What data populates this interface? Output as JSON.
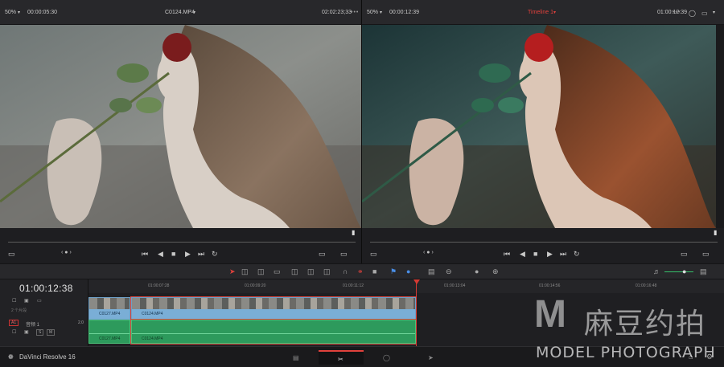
{
  "left_viewer": {
    "zoom": "50%",
    "source_timecode": "00:00:05:30",
    "clip_name": "C0124.MP4",
    "duration": "02:02:23;33",
    "more": "•••"
  },
  "right_viewer": {
    "zoom": "50%",
    "source_timecode": "00:00:12:39",
    "timeline_name": "Timeline 1",
    "record_timecode": "01:00:12:39",
    "more": "•••"
  },
  "timeline": {
    "timecode": "01:00:12:38",
    "ruler_ticks": [
      "01:00:07:28",
      "01:00:09:20",
      "01:00:11:12",
      "01:00:13:04",
      "01:00:14:56",
      "01:00:16:48"
    ],
    "video_track_name": "2 个片段",
    "audio_track_id": "A1",
    "audio_track_name": "音频 1",
    "audio_level": "2.0",
    "audio_s": "S",
    "audio_m": "M",
    "clips": {
      "v1_a": "C0127.MP4",
      "v1_b": "C0124.MP4",
      "a1_a": "C0127.MP4",
      "a1_b": "C0124.MP4"
    }
  },
  "bottom_bar": {
    "app_name": "DaVinci Resolve 16"
  },
  "watermark": {
    "logo": "M",
    "cn": "麻豆约拍",
    "en": "MODEL PHOTOGRAPH"
  },
  "colors": {
    "accent": "#e0413c",
    "video_clip": "#7aaed6",
    "audio_clip": "#2d9a5c"
  }
}
